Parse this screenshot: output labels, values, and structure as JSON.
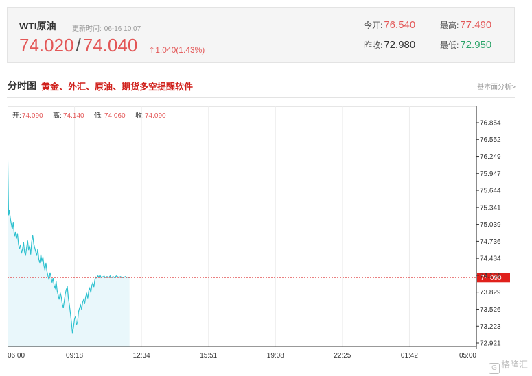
{
  "quote": {
    "name": "WTI原油",
    "update_label": "更新时间:",
    "update_time": "06-16 10:07",
    "bid": "74.020",
    "ask": "74.040",
    "slash": "/",
    "change_arrow": "🡑",
    "change": "1.040(1.43%)",
    "open_label": "今开:",
    "open": "76.540",
    "high_label": "最高:",
    "high": "77.490",
    "prev_close_label": "昨收:",
    "prev_close": "72.980",
    "low_label": "最低:",
    "low": "72.950",
    "colors": {
      "up": "#e35757",
      "down": "#2aa368"
    }
  },
  "section": {
    "title": "分时图",
    "promo_link": "黄金、外汇、原油、期货多空提醒软件",
    "analysis_link": "基本面分析>"
  },
  "ohlc_bar": {
    "open_label": "开:",
    "open": "74.090",
    "high_label": "高:",
    "high": "74.140",
    "low_label": "低:",
    "low": "74.060",
    "close_label": "收:",
    "close": "74.090"
  },
  "watermark": {
    "logo_icon": "gelonghui-logo-icon",
    "text": "格隆汇"
  },
  "chart_data": {
    "type": "area",
    "y_ticks": [
      "76.854",
      "76.552",
      "76.249",
      "75.947",
      "75.644",
      "75.341",
      "75.039",
      "74.736",
      "74.434",
      "74.131",
      "73.829",
      "73.526",
      "73.223",
      "72.921"
    ],
    "x_ticks": [
      "06:00",
      "09:18",
      "12:34",
      "15:51",
      "19:08",
      "22:25",
      "01:42",
      "05:00"
    ],
    "ylim": [
      72.921,
      76.854
    ],
    "reference_price": 74.09,
    "current_price_label": "74.090",
    "x_minutes_range": [
      0,
      1380
    ],
    "grid": true,
    "series": [
      {
        "x": [
          0,
          3,
          5,
          8,
          11,
          14,
          17,
          20,
          23,
          26,
          29,
          32,
          35,
          38,
          41,
          44,
          47,
          50,
          53,
          56,
          59,
          62,
          65,
          68,
          71,
          74,
          77,
          80,
          83,
          86,
          89,
          92,
          95,
          98,
          101,
          104,
          107,
          110,
          113,
          116,
          119,
          122,
          125,
          128,
          131,
          134,
          137,
          140,
          143,
          146,
          149,
          152,
          155,
          158,
          161,
          164,
          167,
          170,
          173,
          176,
          179,
          182,
          185,
          188,
          191,
          194,
          197,
          200,
          203,
          206,
          209,
          212,
          215,
          218,
          221,
          224,
          227,
          230,
          233,
          236,
          239,
          242,
          245,
          248,
          251,
          254,
          257,
          260,
          263,
          266,
          269,
          272,
          275,
          278,
          281,
          284,
          287,
          290,
          293,
          296,
          299,
          302,
          305,
          308,
          311,
          314,
          317,
          320,
          323,
          326,
          329,
          332,
          335,
          338,
          341,
          344,
          347,
          350,
          353,
          356,
          359
        ],
        "values": [
          76.55,
          75.2,
          75.3,
          75.15,
          75.05,
          74.95,
          75.08,
          74.82,
          74.9,
          74.78,
          74.88,
          74.7,
          74.6,
          74.68,
          74.52,
          74.6,
          74.72,
          74.55,
          74.48,
          74.62,
          74.75,
          74.58,
          74.66,
          74.5,
          74.72,
          74.85,
          74.7,
          74.62,
          74.55,
          74.48,
          74.6,
          74.42,
          74.35,
          74.5,
          74.38,
          74.46,
          74.3,
          74.22,
          74.35,
          74.2,
          74.12,
          74.05,
          74.18,
          74.1,
          74.0,
          74.08,
          73.95,
          73.9,
          74.02,
          73.85,
          73.78,
          73.7,
          73.82,
          73.75,
          73.62,
          73.55,
          73.68,
          73.8,
          73.88,
          73.92,
          73.72,
          73.6,
          73.45,
          73.3,
          73.1,
          73.2,
          73.35,
          73.4,
          73.25,
          73.3,
          73.48,
          73.55,
          73.6,
          73.52,
          73.65,
          73.7,
          73.62,
          73.75,
          73.8,
          73.72,
          73.85,
          73.9,
          73.82,
          73.95,
          74.0,
          73.92,
          74.05,
          74.1,
          74.08,
          74.12,
          74.1,
          74.14,
          74.09,
          74.11,
          74.1,
          74.12,
          74.09,
          74.1,
          74.11,
          74.09,
          74.1,
          74.12,
          74.09,
          74.1,
          74.11,
          74.09,
          74.1,
          74.12,
          74.11,
          74.1,
          74.09,
          74.11,
          74.1,
          74.09,
          74.09,
          74.1,
          74.11,
          74.09,
          74.1,
          74.09,
          74.09
        ]
      }
    ]
  }
}
